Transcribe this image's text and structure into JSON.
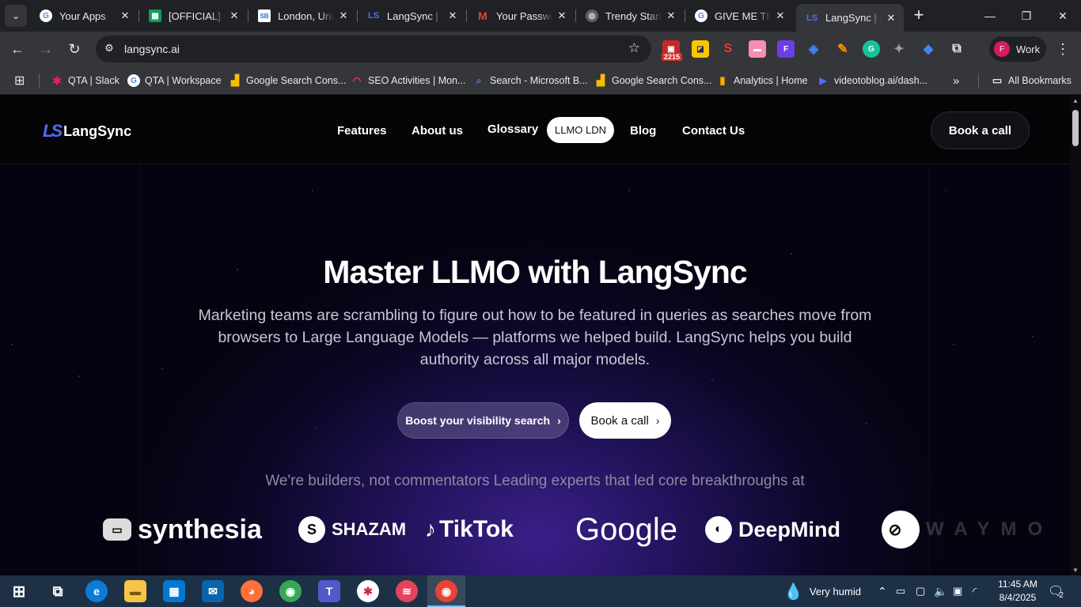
{
  "browser": {
    "tabs": [
      {
        "title": "Your Apps",
        "favicon": "google-icon",
        "active": false
      },
      {
        "title": "[OFFICIAL] La",
        "favicon": "sheets-icon",
        "active": false
      },
      {
        "title": "London, Unit",
        "favicon": "sb-icon",
        "active": false
      },
      {
        "title": "LangSync | La",
        "favicon": "langsync-icon",
        "active": false
      },
      {
        "title": "Your Passwo",
        "favicon": "gmail-icon",
        "active": false
      },
      {
        "title": "Trendy Startu",
        "favicon": "globe-icon",
        "active": false
      },
      {
        "title": "GIVE ME THE",
        "favicon": "google-icon",
        "active": false
      },
      {
        "title": "LangSync | La",
        "favicon": "langsync-icon",
        "active": true
      }
    ],
    "url": "langsync.ai",
    "extension_badge": "2215",
    "profile_label": "Work",
    "profile_initial": "F",
    "bookmarks": [
      {
        "label": "QTA | Slack",
        "icon": "slack-icon"
      },
      {
        "label": "QTA | Workspace",
        "icon": "google-icon"
      },
      {
        "label": "Google Search Cons...",
        "icon": "search-console-icon"
      },
      {
        "label": "SEO Activities | Mon...",
        "icon": "monday-icon"
      },
      {
        "label": "Search - Microsoft B...",
        "icon": "search-icon"
      },
      {
        "label": "Google Search Cons...",
        "icon": "search-console-icon"
      },
      {
        "label": "Analytics | Home",
        "icon": "analytics-icon"
      },
      {
        "label": "videotoblog.ai/dash...",
        "icon": "videotoblog-icon"
      }
    ],
    "all_bookmarks_label": "All Bookmarks"
  },
  "site": {
    "logo_text": "LangSync",
    "logo_mark": "LS",
    "nav": [
      "Features",
      "About us",
      "Glossary",
      "LLMO LDN",
      "Blog",
      "Contact Us"
    ],
    "header_cta": "Book a call",
    "hero_title": "Master LLMO with LangSync",
    "hero_subtitle": "Marketing teams are scrambling to figure out how to be featured in queries as searches move from browsers to Large Language Models — platforms we helped build. LangSync helps you build authority across all major models.",
    "primary_cta": "Boost your visibility search",
    "secondary_cta": "Book a call",
    "builders_text": "We're builders, not commentators  Leading experts that led core breakthroughs at",
    "brands": [
      "synthesia",
      "SHAZAM",
      "TikTok",
      "Google",
      "DeepMind",
      "WAYMO"
    ]
  },
  "taskbar": {
    "weather": "Very humid",
    "time": "11:45 AM",
    "date": "8/4/2025",
    "notifications": "2"
  },
  "colors": {
    "accent": "#4f6cff",
    "hero_glow": "#3a1f8a",
    "taskbar": "#1e3046"
  }
}
